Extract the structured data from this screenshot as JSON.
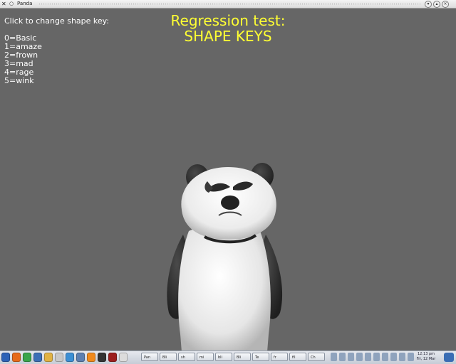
{
  "window": {
    "title": "Panda",
    "app_icon": "x-icon",
    "controls": [
      "minimize",
      "maximize",
      "close"
    ]
  },
  "instructions": {
    "prompt": "Click to change shape key:",
    "keys": [
      "0=Basic",
      "1=amaze",
      "2=frown",
      "3=mad",
      "4=rage",
      "5=wink"
    ]
  },
  "heading": {
    "line1": "Regression test:",
    "line2": "SHAPE KEYS",
    "color": "#ffff33"
  },
  "viewport": {
    "background": "#666666"
  },
  "taskbar": {
    "launchers": [
      {
        "icon": "kde-menu-icon",
        "color": "#2d62b7"
      },
      {
        "icon": "firefox-icon",
        "color": "#e66a1a"
      },
      {
        "icon": "chrome-icon",
        "color": "#3aa54b"
      },
      {
        "icon": "thunderbird-icon",
        "color": "#3b6fb6"
      },
      {
        "icon": "folder-icon",
        "color": "#e0b243"
      },
      {
        "icon": "text-editor-icon",
        "color": "#c8c8c8"
      },
      {
        "icon": "network-icon",
        "color": "#3c8fd4"
      },
      {
        "icon": "settings-icon",
        "color": "#5c7fb0"
      },
      {
        "icon": "vlc-icon",
        "color": "#f08a1c"
      },
      {
        "icon": "terminal-icon",
        "color": "#333333"
      },
      {
        "icon": "office-icon",
        "color": "#9c1e1e"
      },
      {
        "icon": "viewer-icon",
        "color": "#dcdcdc"
      }
    ],
    "tasks": [
      "Pan",
      "Bli",
      "sh",
      "mi",
      "bli",
      "Bli",
      "Te",
      "fr",
      "fil",
      "Ch"
    ],
    "tray_count": 10,
    "clock": {
      "time": "12:13 pm",
      "date": "Fri, 12 Mar"
    }
  }
}
